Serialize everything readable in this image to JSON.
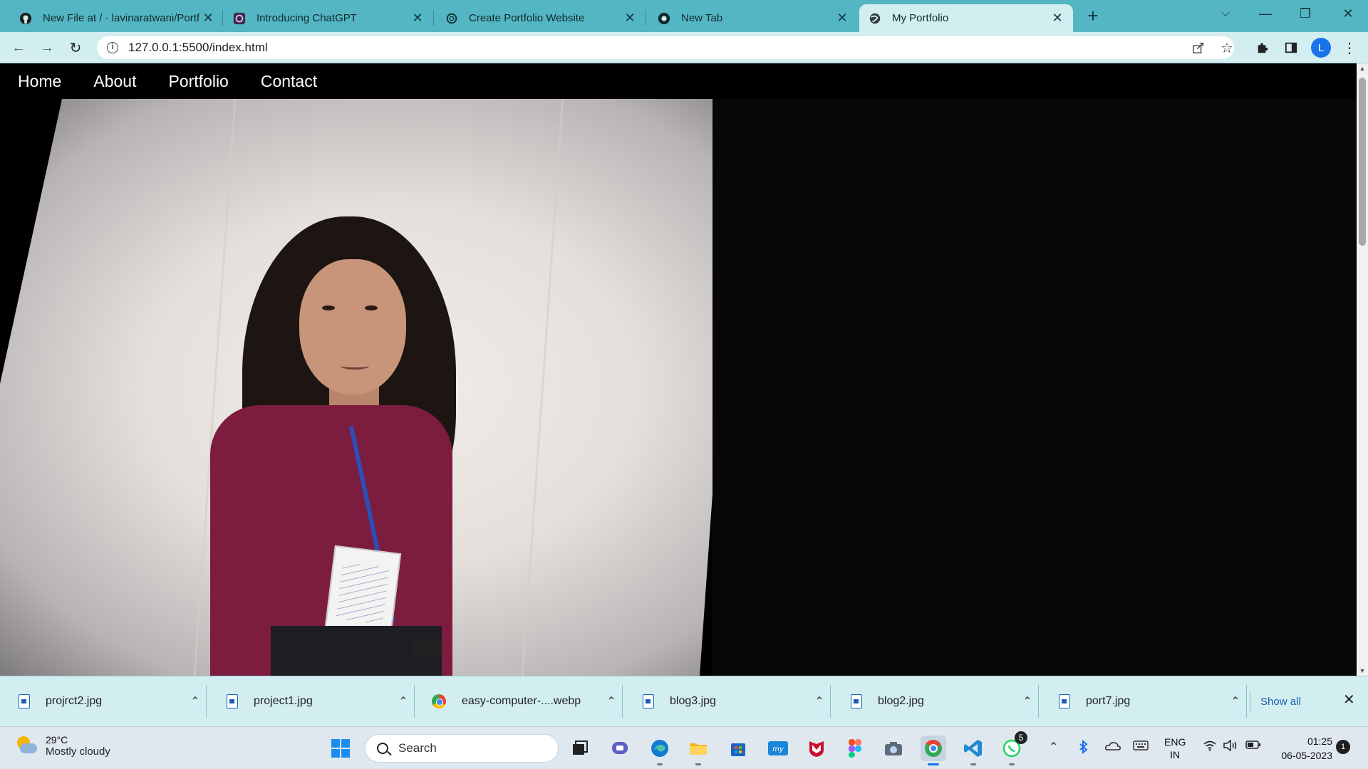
{
  "browser": {
    "tabs": [
      {
        "title": "New File at / · lavinaratwani/Portf",
        "icon": "github-icon",
        "active": false
      },
      {
        "title": "Introducing ChatGPT",
        "icon": "chatgpt-icon",
        "active": false
      },
      {
        "title": "Create Portfolio Website",
        "icon": "openai-icon",
        "active": false
      },
      {
        "title": "New Tab",
        "icon": "chrome-icon",
        "active": false
      },
      {
        "title": "My Portfolio",
        "icon": "globe-icon",
        "active": true
      }
    ],
    "url": "127.0.0.1:5500/index.html",
    "profile_initial": "L"
  },
  "site": {
    "nav": [
      "Home",
      "About",
      "Portfolio",
      "Contact"
    ]
  },
  "downloads": {
    "items": [
      {
        "name": "projrct2.jpg",
        "icon": "image-file-icon"
      },
      {
        "name": "project1.jpg",
        "icon": "image-file-icon"
      },
      {
        "name": "easy-computer-....webp",
        "icon": "chrome-icon"
      },
      {
        "name": "blog3.jpg",
        "icon": "image-file-icon"
      },
      {
        "name": "blog2.jpg",
        "icon": "image-file-icon"
      },
      {
        "name": "port7.jpg",
        "icon": "image-file-icon"
      }
    ],
    "show_all": "Show all"
  },
  "taskbar": {
    "weather_temp": "29°C",
    "weather_desc": "Mostly cloudy",
    "search_label": "Search",
    "whatsapp_badge": "5",
    "language_line1": "ENG",
    "language_line2": "IN",
    "time": "01:25",
    "date": "06-05-2023",
    "notification_count": "1"
  }
}
